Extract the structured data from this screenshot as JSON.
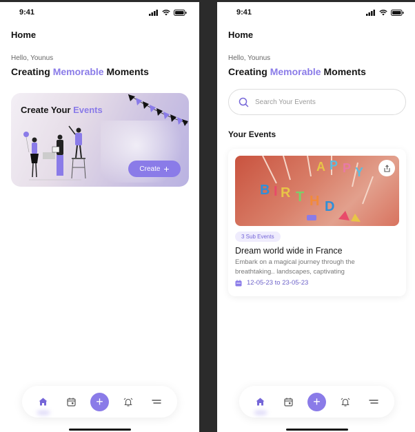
{
  "status": {
    "time": "9:41"
  },
  "header": {
    "title": "Home"
  },
  "greeting": {
    "hello": "Hello, Younus",
    "headline_pre": "Creating ",
    "headline_accent": "Memorable",
    "headline_post": " Moments"
  },
  "create_card": {
    "title_pre": "Create Your ",
    "title_accent": "Events",
    "button_label": "Create"
  },
  "search": {
    "placeholder": "Search Your Events"
  },
  "events_section": {
    "title": "Your Events"
  },
  "event": {
    "badge": "3 Sub Events",
    "title": "Dream world wide in France",
    "description": "Embark on a magical journey through the breathtaking.. landscapes, captivating",
    "date": "12-05-23 to 23-05-23",
    "image_text": "HAPPY BIRTHDAY"
  },
  "nav": {
    "items": [
      "home-icon",
      "calendar-icon",
      "add-icon",
      "alarm-icon",
      "menu-icon"
    ]
  },
  "colors": {
    "accent": "#8a7be8",
    "text": "#151515"
  }
}
